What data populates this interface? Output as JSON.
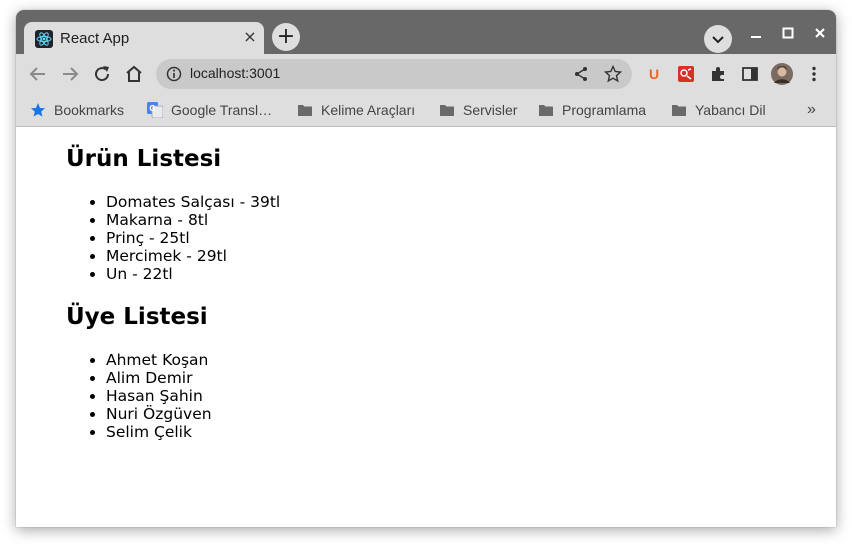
{
  "browser": {
    "tab_title": "React App",
    "tab_close": "×",
    "new_tab": "+",
    "url": "localhost:3001"
  },
  "bookmarks": [
    {
      "label": "Bookmarks",
      "icon": "star-icon"
    },
    {
      "label": "Google Transl…",
      "icon": "google-translate-icon"
    },
    {
      "label": "Kelime Araçları",
      "icon": "folder-icon"
    },
    {
      "label": "Servisler",
      "icon": "folder-icon"
    },
    {
      "label": "Programlama",
      "icon": "folder-icon"
    },
    {
      "label": "Yabancı Dil",
      "icon": "folder-icon"
    }
  ],
  "bookmarks_more": "»",
  "extensions": {
    "ublock_letter": "U"
  },
  "page": {
    "products_heading": "Ürün Listesi",
    "products": [
      "Domates Salçası - 39tl",
      "Makarna - 8tl",
      "Prinç - 25tl",
      "Mercimek - 29tl",
      "Un - 22tl"
    ],
    "members_heading": "Üye Listesi",
    "members": [
      "Ahmet Koşan",
      "Alim Demir",
      "Hasan Şahin",
      "Nuri Özgüven",
      "Selim Çelik"
    ]
  },
  "colors": {
    "titlebar": "#686868",
    "toolbar": "#dedede",
    "omnibox": "#c9c9c9",
    "bookmark_star": "#1a73e8",
    "ublock": "#e8672b",
    "ext_red": "#d93025",
    "react_cyan": "#61dafb"
  }
}
